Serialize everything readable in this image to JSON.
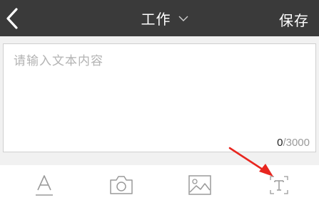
{
  "header": {
    "back_icon": "chevron-left-icon",
    "title": "工作",
    "title_dropdown_icon": "chevron-down-icon",
    "save_label": "保存"
  },
  "editor": {
    "placeholder": "请输入文本内容",
    "value": "",
    "char_count": "0",
    "char_separator": "/",
    "char_limit": "3000"
  },
  "toolbar": {
    "items": [
      {
        "icon": "text-format-icon"
      },
      {
        "icon": "camera-icon"
      },
      {
        "icon": "image-icon"
      },
      {
        "icon": "text-box-icon"
      }
    ]
  },
  "colors": {
    "header_bg": "#3a3a3a",
    "icon_gray": "#9a9a9a",
    "annotation_red": "#e8261f"
  }
}
